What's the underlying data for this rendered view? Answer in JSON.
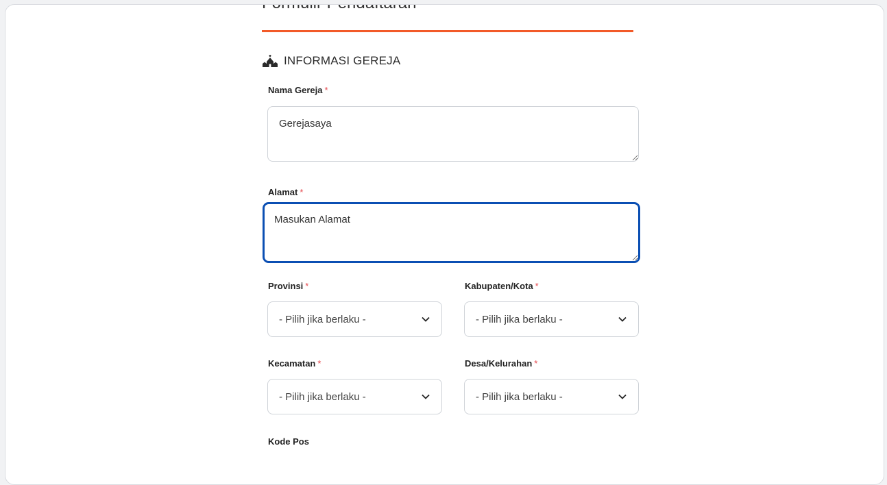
{
  "colors": {
    "accent": "#f25a28",
    "required": "#e5484d",
    "focus": "#0b4fb3"
  },
  "form": {
    "title": "Formulir Pendaftaran",
    "section": {
      "icon": "church-icon",
      "title": "INFORMASI GEREJA"
    },
    "fields": {
      "nama_gereja": {
        "label": "Nama Gereja",
        "required_mark": "*",
        "value": "Gerejasaya"
      },
      "alamat": {
        "label": "Alamat",
        "required_mark": "*",
        "value": "Masukan Alamat"
      },
      "provinsi": {
        "label": "Provinsi",
        "required_mark": "*",
        "value": "- Pilih jika berlaku -"
      },
      "kabupaten": {
        "label": "Kabupaten/Kota",
        "required_mark": "*",
        "value": "- Pilih jika berlaku -"
      },
      "kecamatan": {
        "label": "Kecamatan",
        "required_mark": "*",
        "value": "- Pilih jika berlaku -"
      },
      "desa": {
        "label": "Desa/Kelurahan",
        "required_mark": "*",
        "value": "- Pilih jika berlaku -"
      },
      "kode_pos": {
        "label": "Kode Pos"
      }
    }
  }
}
